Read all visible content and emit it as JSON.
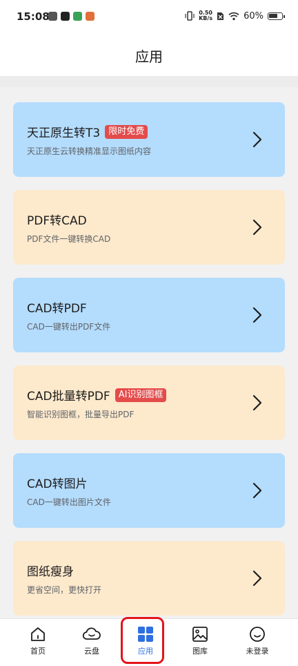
{
  "status_bar": {
    "time": "15:08",
    "speed_top": "0.50",
    "speed_bottom": "KB/s",
    "battery": "60%"
  },
  "header": {
    "title": "应用"
  },
  "cards": [
    {
      "title": "天正原生转T3",
      "badge": "限时免费",
      "subtitle": "天正原生云转换精准显示图纸内容",
      "color": "#b4dcfd"
    },
    {
      "title": "PDF转CAD",
      "badge": "",
      "subtitle": "PDF文件一键转换CAD",
      "color": "#fde9cc"
    },
    {
      "title": "CAD转PDF",
      "badge": "",
      "subtitle": "CAD一键转出PDF文件",
      "color": "#b4dcfd"
    },
    {
      "title": "CAD批量转PDF",
      "badge": "AI识别图框",
      "subtitle": "智能识别图框，批量导出PDF",
      "color": "#fde9cc"
    },
    {
      "title": "CAD转图片",
      "badge": "",
      "subtitle": "CAD一键转出图片文件",
      "color": "#b4dcfd"
    },
    {
      "title": "图纸瘦身",
      "badge": "",
      "subtitle": "更省空间，更快打开",
      "color": "#fde9cc"
    }
  ],
  "tabs": [
    {
      "label": "首页",
      "icon": "home-icon"
    },
    {
      "label": "云盘",
      "icon": "cloud-icon"
    },
    {
      "label": "应用",
      "icon": "apps-grid-icon"
    },
    {
      "label": "图库",
      "icon": "gallery-icon"
    },
    {
      "label": "未登录",
      "icon": "smiley-face-icon"
    }
  ],
  "colors": {
    "accent": "#2f6fe0",
    "badge": "#e44b4b",
    "highlight": "#e3141b"
  }
}
